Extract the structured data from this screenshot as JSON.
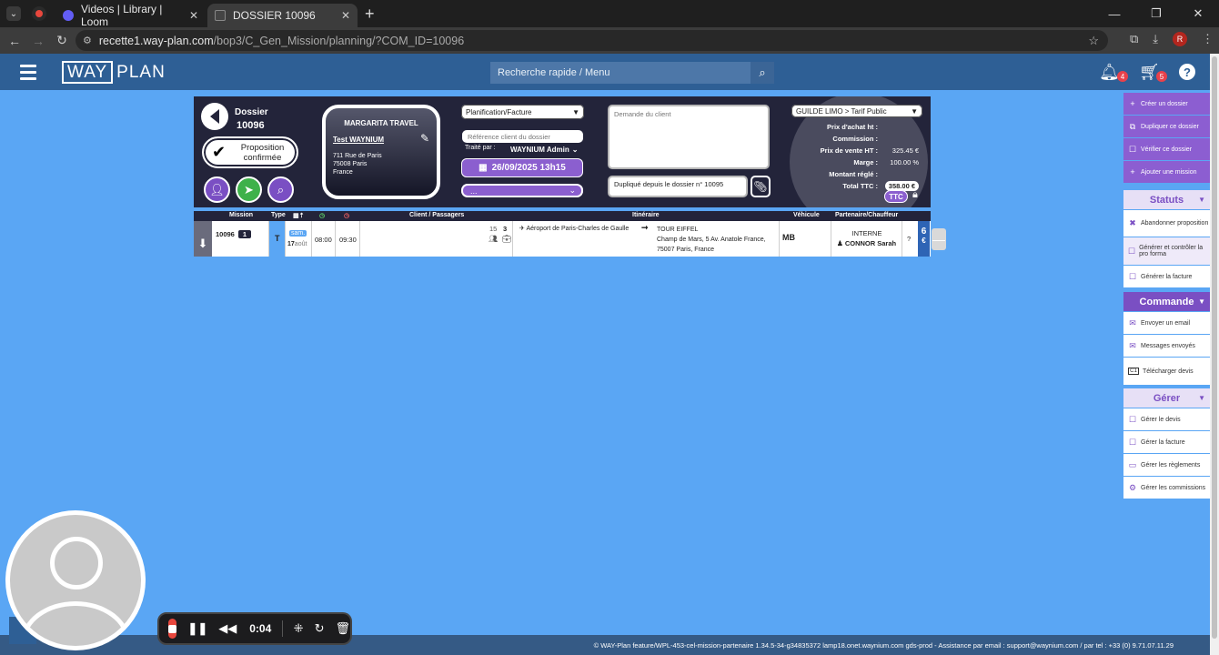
{
  "browser": {
    "tabs": [
      {
        "title": "Videos | Library | Loom",
        "active": false
      },
      {
        "title": "DOSSIER 10096",
        "active": true
      }
    ],
    "url_host": "recette1.way-plan.com",
    "url_path": "/bop3/C_Gen_Mission/planning/?COM_ID=10096",
    "profile_initial": "R"
  },
  "header": {
    "logo_box": "WAY",
    "logo_text": "PLAN",
    "search_placeholder": "Recherche rapide / Menu",
    "notif_count": "4",
    "cart_count": "5",
    "help": "?"
  },
  "dossier": {
    "label": "Dossier",
    "number": "10096",
    "status_line1": "Proposition",
    "status_line2": "confirmée"
  },
  "client": {
    "company": "MARGARITA TRAVEL",
    "user": "Test WAYNIUM",
    "address_line1": "711 Rue de Paris",
    "address_line2": "75008 Paris",
    "address_line3": "France"
  },
  "planning": {
    "type_select": "Planification/Facture",
    "ref_placeholder": "Référence client du dossier",
    "handled_by_label": "Traité par :",
    "handled_by": "WAYNIUM Admin",
    "date": "26/09/2025 13h15",
    "extra_select": "..."
  },
  "notes": {
    "demande_placeholder": "Demande du client",
    "duplicate_text": "Dupliqué depuis le dossier n° 10095"
  },
  "pricing": {
    "tarif": "GUILDE LIMO > Tarif Public",
    "rows": [
      {
        "k": "Prix d'achat ht :",
        "v": ""
      },
      {
        "k": "Commission :",
        "v": ""
      },
      {
        "k": "Prix de vente HT :",
        "v": "325.45 €"
      },
      {
        "k": "Marge :",
        "v": "100.00 %"
      },
      {
        "k": "Montant réglé :",
        "v": ""
      }
    ],
    "total_label": "Total TTC :",
    "total_value": "358.00 €",
    "ttc_button": "TTC"
  },
  "mission_table": {
    "headers": {
      "mission": "Mission",
      "type": "Type",
      "client": "Client / Passagers",
      "itinerary": "Itinéraire",
      "vehicle": "Véhicule",
      "partner": "Partenaire/Chauffeur"
    },
    "row": {
      "mission": "10096",
      "count": "1",
      "type": "T",
      "day": "sam.",
      "date_num": "17",
      "month": "août",
      "start": "08:00",
      "end": "09:30",
      "passengers": "15",
      "luggage": "3",
      "from": "Aéroport de Paris-Charles de Gaulle",
      "to_name": "TOUR EIFFEL",
      "to_line1": "Champ de Mars, 5 Av. Anatole France,",
      "to_line2": "75007 Paris, France",
      "vehicle": "MB",
      "partner": "INTERNE",
      "driver": "CONNOR Sarah",
      "extra": "?",
      "side_num": "6"
    }
  },
  "actions": {
    "top": [
      {
        "label": "Créer un dossier",
        "icon": "+"
      },
      {
        "label": "Dupliquer ce dossier",
        "icon": "⧉"
      },
      {
        "label": "Vérifier ce dossier",
        "icon": "☐"
      },
      {
        "label": "Ajouter une mission",
        "icon": "+"
      }
    ],
    "statuts_title": "Statuts",
    "statuts": [
      {
        "label": "Abandonner proposition",
        "icon": "✖"
      },
      {
        "label": "Générer et contrôler la pro forma",
        "icon": "☐"
      },
      {
        "label": "Générer la facture",
        "icon": "☐"
      }
    ],
    "commande_title": "Commande",
    "commande": [
      {
        "label": "Envoyer un email",
        "icon": "✉"
      },
      {
        "label": "Messages envoyés",
        "icon": "✉"
      },
      {
        "label": "Télécharger devis",
        "icon": "C1"
      }
    ],
    "gerer_title": "Gérer",
    "gerer": [
      {
        "label": "Gérer le devis",
        "icon": "☐"
      },
      {
        "label": "Gérer la facture",
        "icon": "☐"
      },
      {
        "label": "Gérer les règlements",
        "icon": "▭"
      },
      {
        "label": "Gérer les commissions",
        "icon": "⚙"
      }
    ]
  },
  "footer": {
    "text": "© WAY-Plan feature/WPL-453-cel-mission-partenaire 1.34.5-34-g34835372 lamp18.onet.waynium.com gds-prod - Assistance par email : support@waynium.com / par tel : +33 (0) 9.71.07.11.29"
  },
  "loom": {
    "time": "0:04"
  }
}
